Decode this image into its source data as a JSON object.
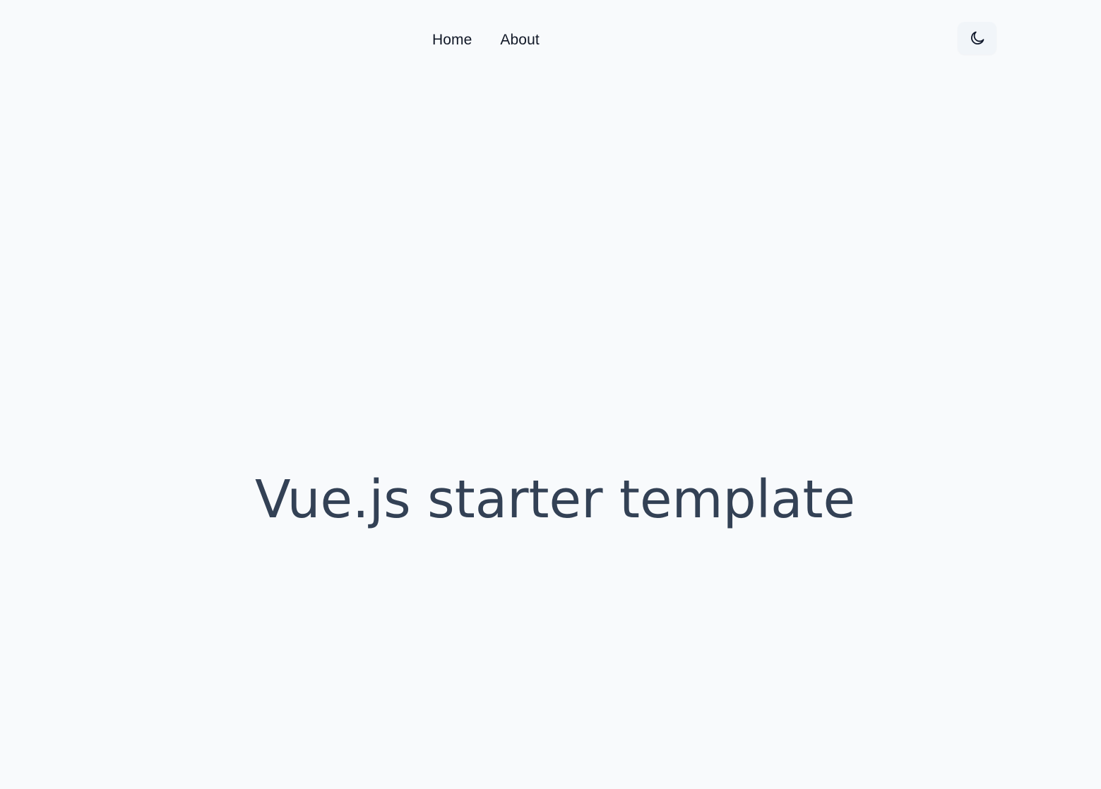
{
  "nav": {
    "items": [
      {
        "label": "Home"
      },
      {
        "label": "About"
      }
    ]
  },
  "theme_toggle": {
    "icon": "moon-icon"
  },
  "hero": {
    "title": "Vue.js starter template"
  },
  "colors": {
    "background": "#f8fafc",
    "nav_text": "#111827",
    "title_text": "#334155",
    "toggle_bg": "#f1f5f9"
  }
}
